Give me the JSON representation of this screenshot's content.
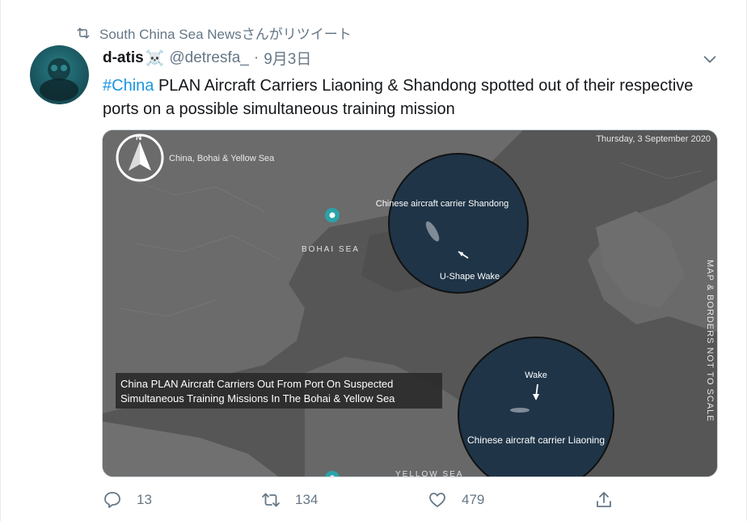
{
  "retweet": {
    "text": "South China Sea Newsさんがリツイート"
  },
  "author": {
    "name": "d-atis",
    "emoji": "☠️",
    "handle": "@detresfa_",
    "separator": "·",
    "date": "9月3日"
  },
  "tweet": {
    "hashtag": "#China",
    "body": " PLAN Aircraft Carriers Liaoning & Shandong spotted out of their respective ports on a possible simultaneous training mission"
  },
  "image": {
    "date_label": "Thursday, 3 September 2020",
    "north_label": "N",
    "region_label": "China, Bohai & Yellow Sea",
    "bohai_label": "BOHAI SEA",
    "yellow_label": "YELLOW SEA",
    "shandong_label": "Chinese aircraft carrier Shandong",
    "ushape_label": "U-Shape Wake",
    "wake_label": "Wake",
    "liaoning_label": "Chinese aircraft carrier Liaoning",
    "caption_line1": "China PLAN Aircraft Carriers Out From Port On Suspected",
    "caption_line2": "Simultaneous Training Missions In The Bohai & Yellow Sea",
    "side_text": "MAP & BORDERS NOT TO SCALE"
  },
  "actions": {
    "reply_count": "13",
    "retweet_count": "134",
    "like_count": "479"
  },
  "colors": {
    "link": "#1b95e0",
    "muted": "#657786",
    "map_land": "#6b6b6b",
    "map_sea": "#4f4f4f",
    "inset": "#1e3347"
  }
}
